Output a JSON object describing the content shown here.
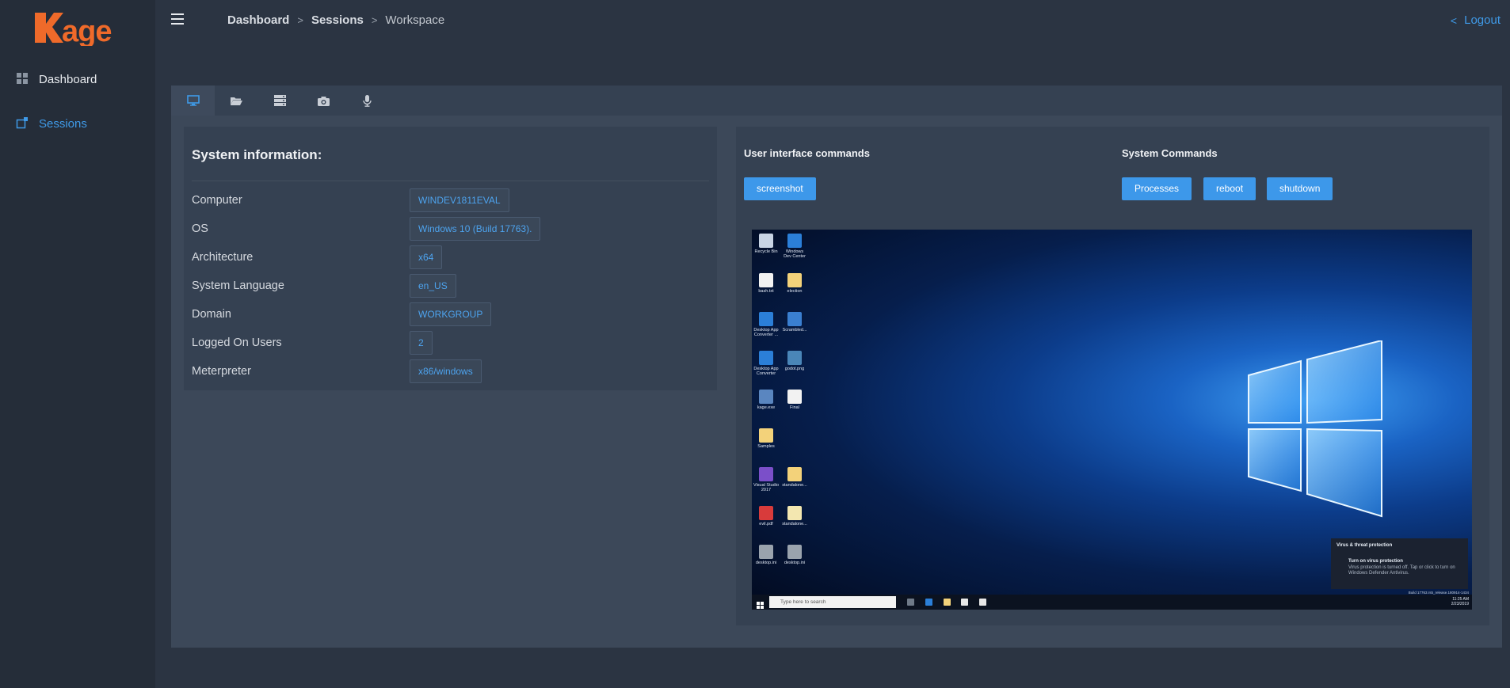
{
  "app": {
    "logo_text": "kage"
  },
  "sidebar": {
    "items": [
      {
        "label": "Dashboard",
        "icon": "grid-icon",
        "active": false
      },
      {
        "label": "Sessions",
        "icon": "sessions-icon",
        "active": true
      }
    ]
  },
  "header": {
    "breadcrumb": [
      "Dashboard",
      "Sessions",
      "Workspace"
    ],
    "logout_label": "Logout"
  },
  "tabs": [
    {
      "icon": "desktop-icon",
      "active": true
    },
    {
      "icon": "folder-open-icon",
      "active": false
    },
    {
      "icon": "server-icon",
      "active": false
    },
    {
      "icon": "camera-icon",
      "active": false
    },
    {
      "icon": "microphone-icon",
      "active": false
    }
  ],
  "system_info": {
    "title": "System information:",
    "rows": [
      {
        "label": "Computer",
        "value": "WINDEV1811EVAL"
      },
      {
        "label": "OS",
        "value": "Windows 10 (Build 17763)."
      },
      {
        "label": "Architecture",
        "value": "x64"
      },
      {
        "label": "System Language",
        "value": "en_US"
      },
      {
        "label": "Domain",
        "value": "WORKGROUP"
      },
      {
        "label": "Logged On Users",
        "value": "2"
      },
      {
        "label": "Meterpreter",
        "value": "x86/windows"
      }
    ]
  },
  "ui_commands": {
    "title": "User interface commands",
    "buttons": [
      "screenshot"
    ]
  },
  "system_commands": {
    "title": "System Commands",
    "buttons": [
      "Processes",
      "reboot",
      "shutdown"
    ]
  },
  "screenshot": {
    "desktop_icons": [
      "Recycle Bin",
      "Windows Dev Center",
      "bash.txt",
      "election",
      "Desktop App Converter ...",
      "Scrambled...",
      "Desktop App Converter",
      "godot.png",
      "kage.exe",
      "Final",
      "Samples",
      "",
      "Visual Studio 2017",
      "standalone...",
      "evil.pdf",
      "standalone...",
      "desktop.ini",
      "desktop.ini"
    ],
    "toast_title": "Virus & threat protection",
    "toast_heading": "Turn on virus protection",
    "toast_body": "Virus protection is turned off. Tap or click to turn on Windows Defender Antivirus.",
    "search_placeholder": "Type here to search",
    "tray_time": "11:25 AM",
    "tray_date": "2/23/2019",
    "build_text": "Build 17763.rs5_release.180914-1434"
  },
  "colors": {
    "accent": "#3d98ea",
    "logo": "#ef6a2a",
    "sidebar_bg": "#252d39",
    "page_bg": "#2b3442"
  }
}
